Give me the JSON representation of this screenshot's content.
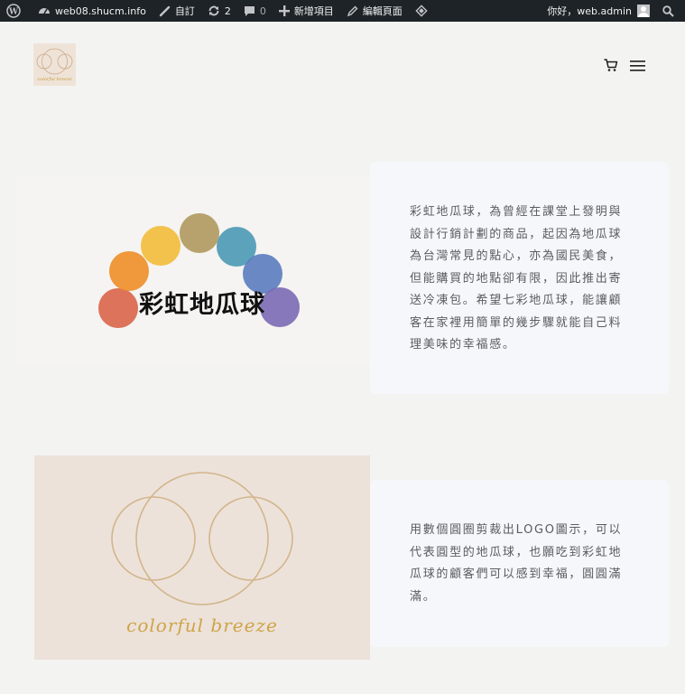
{
  "adminbar": {
    "site_name": "web08.shucm.info",
    "customize_label": "自訂",
    "updates_count": "2",
    "comments_count": "0",
    "new_label": "新增項目",
    "edit_label": "編輯頁面",
    "greeting": "你好，web.admin"
  },
  "header": {
    "logo_text": "colorful breeze"
  },
  "section1": {
    "image_title": "彩虹地瓜球",
    "text": "彩虹地瓜球，為曾經在課堂上發明與設計行銷計劃的商品，起因為地瓜球為台灣常見的點心，亦為國民美食，但能購買的地點卻有限，因此推出寄送冷凍包。希望七彩地瓜球，能讓顧客在家裡用簡單的幾步驟就能自己料理美味的幸福感。",
    "ball_colors": [
      "#d9674d",
      "#ee8f2c",
      "#f2bd3e",
      "#b19a62",
      "#4e9ab6",
      "#5c7ec0",
      "#7c6cb5"
    ]
  },
  "section2": {
    "brand_text": "colorful  breeze",
    "text": "用數個圓圈剪裁出LOGO圖示，可以代表圓型的地瓜球，也願吃到彩虹地瓜球的顧客們可以感到幸福，圓圓滿滿。"
  }
}
